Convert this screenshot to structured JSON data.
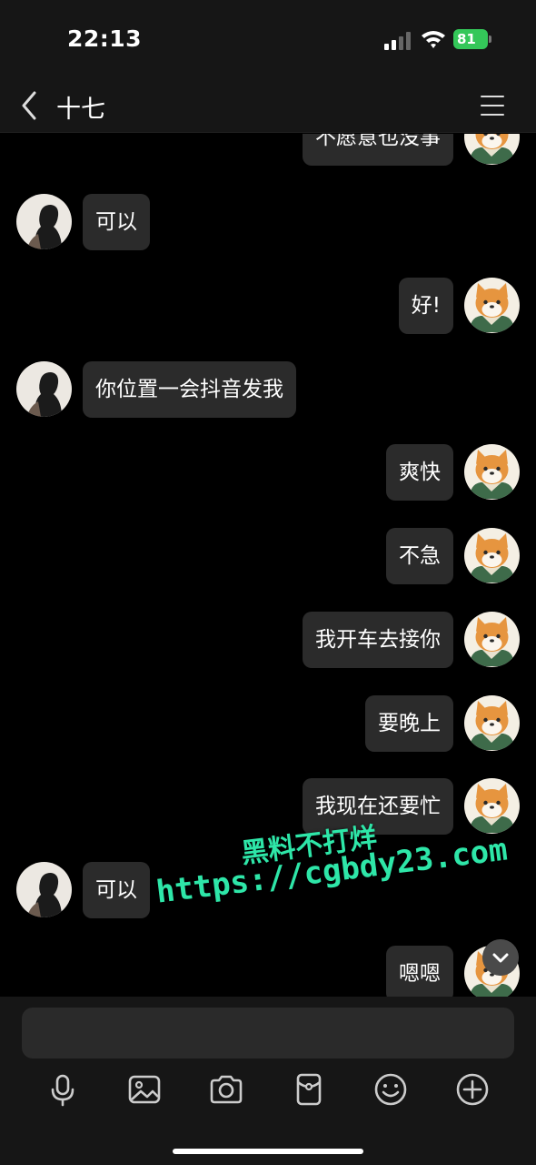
{
  "status_bar": {
    "time": "22:13",
    "battery": "81"
  },
  "header": {
    "title": "十七"
  },
  "messages": [
    {
      "side": "right",
      "text": "不愿意也没事"
    },
    {
      "side": "left",
      "text": "可以"
    },
    {
      "side": "right",
      "text": "好!"
    },
    {
      "side": "left",
      "text": "你位置一会抖音发我"
    },
    {
      "side": "right",
      "text": "爽快"
    },
    {
      "side": "right",
      "text": "不急"
    },
    {
      "side": "right",
      "text": "我开车去接你"
    },
    {
      "side": "right",
      "text": "要晚上"
    },
    {
      "side": "right",
      "text": "我现在还要忙"
    },
    {
      "side": "left",
      "text": "可以"
    },
    {
      "side": "right",
      "text": "嗯嗯"
    }
  ],
  "watermark": {
    "line1": "黑料不打烊",
    "line2": "https://cgbdy23.com"
  },
  "input": {
    "placeholder": ""
  },
  "toolbar_icons": [
    "microphone-icon",
    "image-icon",
    "camera-icon",
    "red-packet-icon",
    "emoji-icon",
    "plus-icon"
  ],
  "colors": {
    "bubble": "#2b2b2b",
    "background": "#000000",
    "battery": "#34c759",
    "watermark": "#2ee6a8"
  }
}
